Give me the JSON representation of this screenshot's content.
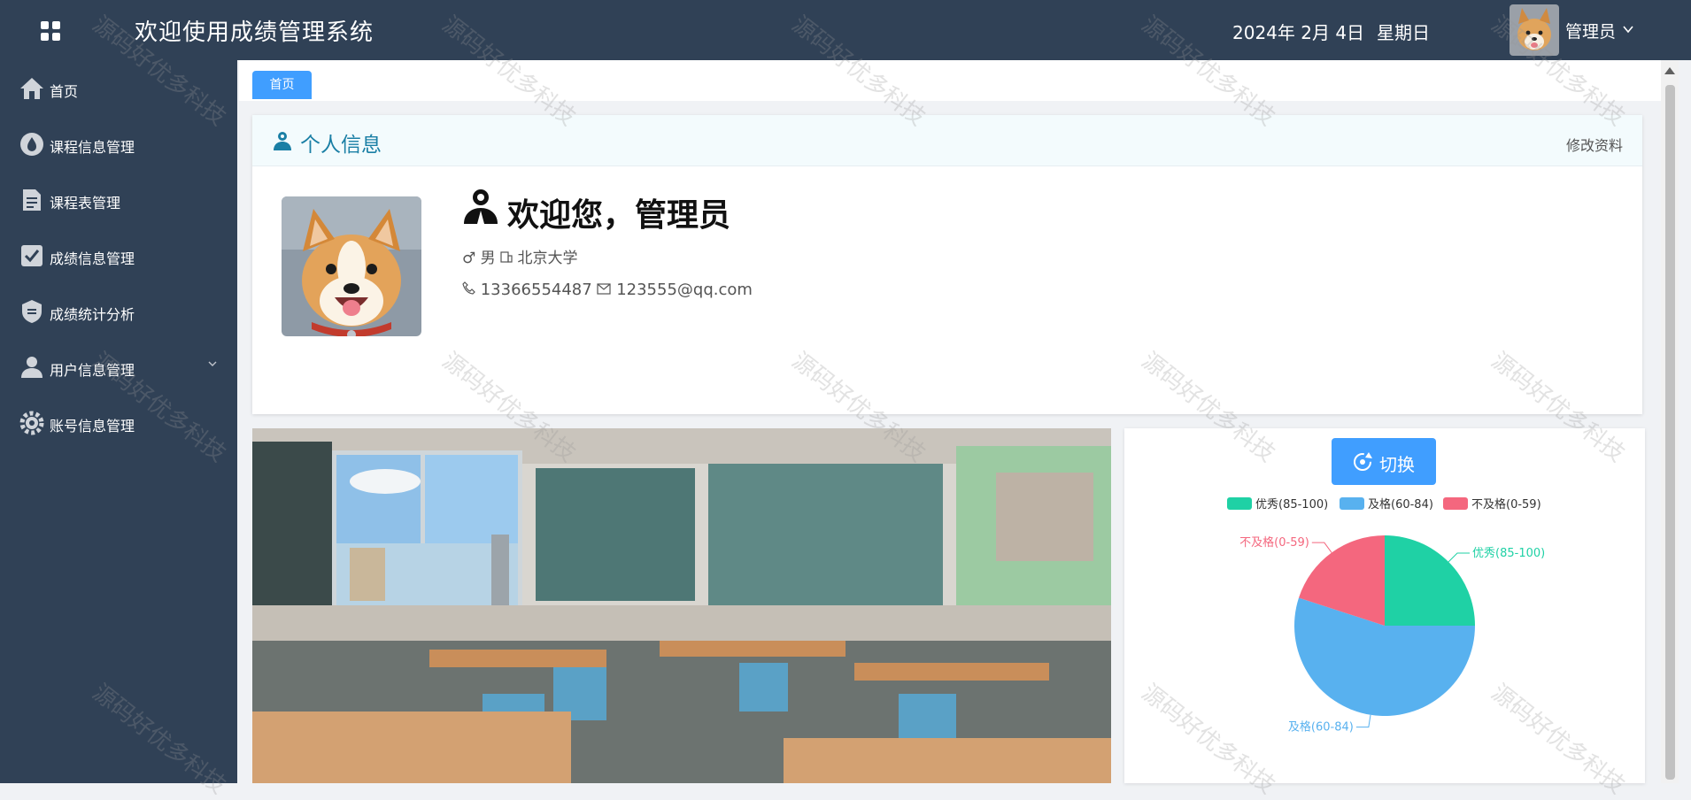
{
  "header": {
    "title": "欢迎使用成绩管理系统",
    "date": "2024年 2月 4日",
    "weekday": "星期日",
    "user": "管理员"
  },
  "sidebar": {
    "items": [
      {
        "label": "首页",
        "icon": "home-icon"
      },
      {
        "label": "课程信息管理",
        "icon": "drop-icon"
      },
      {
        "label": "课程表管理",
        "icon": "document-icon"
      },
      {
        "label": "成绩信息管理",
        "icon": "checkbox-icon"
      },
      {
        "label": "成绩统计分析",
        "icon": "shield-icon"
      },
      {
        "label": "用户信息管理",
        "icon": "user-icon"
      },
      {
        "label": "账号信息管理",
        "icon": "gear-icon"
      }
    ]
  },
  "tabs": {
    "home": "首页"
  },
  "profile": {
    "section_title": "个人信息",
    "edit_label": "修改资料",
    "welcome": "欢迎您，管理员",
    "gender": "男",
    "school": "北京大学",
    "phone": "13366554487",
    "email": "123555@qq.com"
  },
  "chart": {
    "switch_label": "切换"
  },
  "chart_data": {
    "type": "pie",
    "categories": [
      "优秀(85-100)",
      "及格(60-84)",
      "不及格(0-59)"
    ],
    "values": [
      25,
      55,
      20
    ],
    "colors": [
      "#1fd1a5",
      "#58b1ef",
      "#f4677e"
    ],
    "legend_position": "top"
  },
  "watermark": "源码好优多科技",
  "colors": {
    "sidebar": "#304156",
    "accent": "#409eff"
  }
}
